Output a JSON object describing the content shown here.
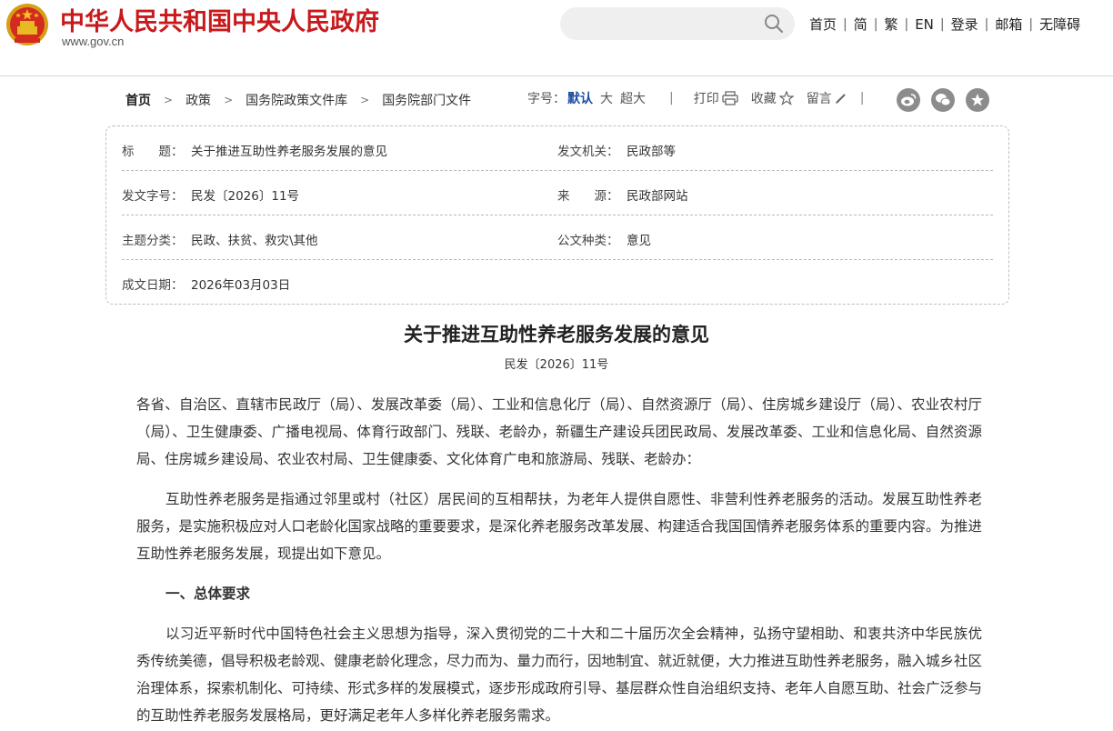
{
  "header": {
    "site_title": "中华人民共和国中央人民政府",
    "site_url": "www.gov.cn",
    "search_placeholder": "",
    "nav": [
      "首页",
      "简",
      "繁",
      "EN",
      "登录",
      "邮箱",
      "无障碍"
    ]
  },
  "colors": {
    "brand_red": "#c8191c",
    "link_blue": "#1a4da1",
    "icon_gray": "#8c8c8c"
  },
  "breadcrumb": [
    "首页",
    "政策",
    "国务院政策文件库",
    "国务院部门文件"
  ],
  "tools": {
    "font_size_label": "字号：",
    "font_sizes": [
      "默认",
      "大",
      "超大"
    ],
    "print": "打印",
    "favorite": "收藏",
    "comment": "留言",
    "share_icons": [
      "weibo-icon",
      "wechat-icon",
      "star-share-icon"
    ]
  },
  "info": {
    "title_label": "标　　题：",
    "title_value": "关于推进互助性养老服务发展的意见",
    "issuer_label": "发文机关：",
    "issuer_value": "民政部等",
    "doc_no_label": "发文字号：",
    "doc_no_value": "民发〔2026〕11号",
    "source_label": "来　　源：",
    "source_value": "民政部网站",
    "topic_label": "主题分类：",
    "topic_value": "民政、扶贫、救灾\\其他",
    "type_label": "公文种类：",
    "type_value": "意见",
    "date_label": "成文日期：",
    "date_value": "2026年03月03日"
  },
  "document": {
    "title": "关于推进互助性养老服务发展的意见",
    "number": "民发〔2026〕11号",
    "addressees": "各省、自治区、直辖市民政厅（局）、发展改革委（局）、工业和信息化厅（局）、自然资源厅（局）、住房城乡建设厅（局）、农业农村厅（局）、卫生健康委、广播电视局、体育行政部门、残联、老龄办，新疆生产建设兵团民政局、发展改革委、工业和信息化局、自然资源局、住房城乡建设局、农业农村局、卫生健康委、文化体育广电和旅游局、残联、老龄办：",
    "intro": "互助性养老服务是指通过邻里或村（社区）居民间的互相帮扶，为老年人提供自愿性、非营利性养老服务的活动。发展互助性养老服务，是实施积极应对人口老龄化国家战略的重要要求，是深化养老服务改革发展、构建适合我国国情养老服务体系的重要内容。为推进互助性养老服务发展，现提出如下意见。",
    "section1_heading": "一、总体要求",
    "section1_text": "以习近平新时代中国特色社会主义思想为指导，深入贯彻党的二十大和二十届历次全会精神，弘扬守望相助、和衷共济中华民族优秀传统美德，倡导积极老龄观、健康老龄化理念，尽力而为、量力而行，因地制宜、就近就便，大力推进互助性养老服务，融入城乡社区治理体系，探索机制化、可持续、形式多样的发展模式，逐步形成政府引导、基层群众性自治组织支持、老年人自愿互助、社会广泛参与的互助性养老服务发展格局，更好满足老年人多样化养老服务需求。"
  }
}
